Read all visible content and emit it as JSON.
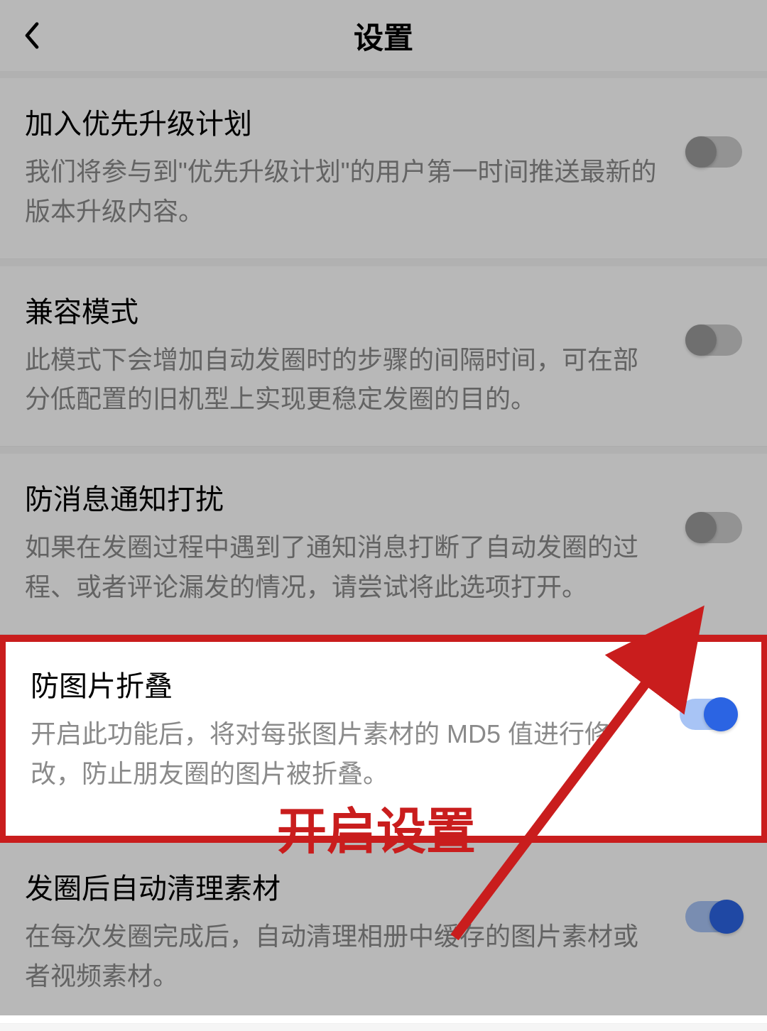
{
  "header": {
    "title": "设置"
  },
  "settings": [
    {
      "title": "加入优先升级计划",
      "description": "我们将参与到\"优先升级计划\"的用户第一时间推送最新的版本升级内容。",
      "enabled": false,
      "highlighted": false
    },
    {
      "title": "兼容模式",
      "description": "此模式下会增加自动发圈时的步骤的间隔时间，可在部分低配置的旧机型上实现更稳定发圈的目的。",
      "enabled": false,
      "highlighted": false
    },
    {
      "title": "防消息通知打扰",
      "description": "如果在发圈过程中遇到了通知消息打断了自动发圈的过程、或者评论漏发的情况，请尝试将此选项打开。",
      "enabled": false,
      "highlighted": false
    },
    {
      "title": "防图片折叠",
      "description": "开启此功能后，将对每张图片素材的 MD5 值进行修改，防止朋友圈的图片被折叠。",
      "enabled": true,
      "highlighted": true
    },
    {
      "title": "发圈后自动清理素材",
      "description": "在每次发圈完成后，自动清理相册中缓存的图片素材或者视频素材。",
      "enabled": true,
      "highlighted": false
    }
  ],
  "annotation": {
    "text": "开启设置"
  }
}
